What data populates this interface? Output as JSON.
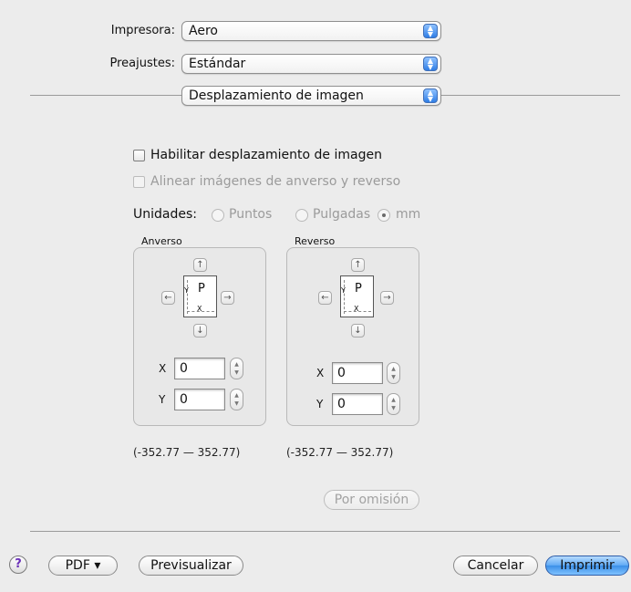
{
  "printer": {
    "label": "Impresora:",
    "value": "Aero"
  },
  "presets": {
    "label": "Preajustes:",
    "value": "Estándar"
  },
  "panel_select": {
    "value": "Desplazamiento de imagen"
  },
  "options": {
    "enable_shift": {
      "label": "Habilitar desplazamiento de imagen",
      "checked": false
    },
    "align_images": {
      "label": "Alinear imágenes de anverso y reverso",
      "checked": false,
      "enabled": false
    }
  },
  "units": {
    "label": "Unidades:",
    "options": [
      "Puntos",
      "Pulgadas",
      "mm"
    ],
    "selected": "mm"
  },
  "front": {
    "title": "Anverso",
    "page_letter": "P",
    "x_label": "X",
    "y_label": "Y",
    "x_value": "0",
    "y_value": "0",
    "range": "(-352.77  —  352.77)"
  },
  "back": {
    "title": "Reverso",
    "page_letter": "P",
    "x_label": "X",
    "y_label": "Y",
    "x_value": "0",
    "y_value": "0",
    "range": "(-352.77  —  352.77)"
  },
  "icons": {
    "up": "↑",
    "down": "↓",
    "left": "←",
    "right": "→",
    "page_y": "Y",
    "page_x": "X"
  },
  "buttons": {
    "defaults": "Por omisión",
    "help": "?",
    "pdf": "PDF ▾",
    "preview": "Previsualizar",
    "cancel": "Cancelar",
    "print": "Imprimir"
  }
}
